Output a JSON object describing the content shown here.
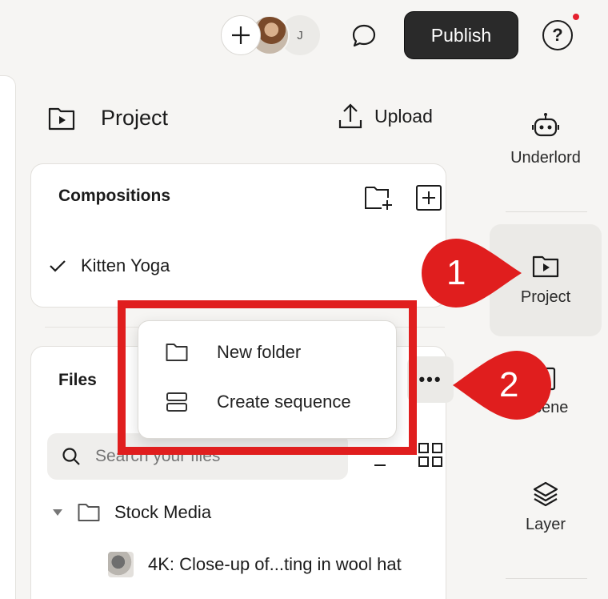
{
  "topbar": {
    "avatar_initial": "J",
    "publish_label": "Publish",
    "help_label": "?"
  },
  "project": {
    "title": "Project",
    "upload_label": "Upload"
  },
  "compositions": {
    "title": "Compositions",
    "items": [
      {
        "label": "Kitten Yoga",
        "selected": true
      }
    ]
  },
  "files": {
    "title": "Files",
    "more_label": "•••",
    "search_placeholder": "Search your files",
    "tree": [
      {
        "label": "Stock Media",
        "expanded": true,
        "children": [
          {
            "label": "4K: Close-up of...ting in wool hat"
          }
        ]
      }
    ]
  },
  "rail": {
    "items": [
      {
        "label": "Underlord",
        "icon": "robot-icon"
      },
      {
        "label": "Project",
        "icon": "project-icon",
        "active": true
      },
      {
        "label": "Scene",
        "icon": "scene-icon"
      },
      {
        "label": "Layer",
        "icon": "layers-icon"
      }
    ]
  },
  "menu": {
    "items": [
      {
        "label": "New folder",
        "icon": "folder-icon"
      },
      {
        "label": "Create sequence",
        "icon": "sequence-icon"
      }
    ]
  },
  "annotations": {
    "callout_1": "1",
    "callout_2": "2",
    "accent_color": "#e01e1e"
  }
}
